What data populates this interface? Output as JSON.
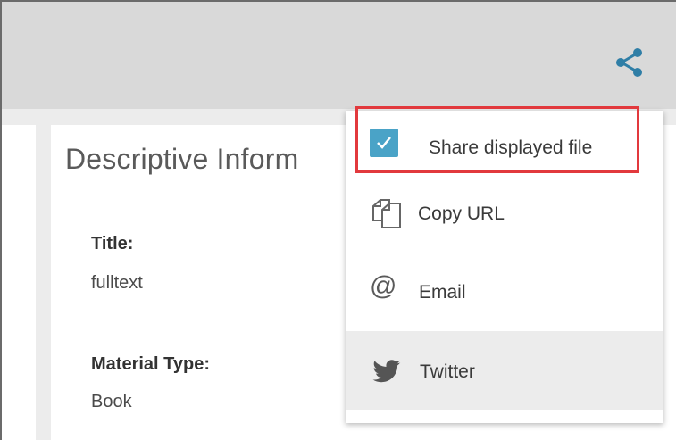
{
  "toolbar": {
    "share_icon": "share-icon"
  },
  "record": {
    "section_heading": "Descriptive Inform",
    "fields": [
      {
        "label": "Title:",
        "value": "fulltext"
      },
      {
        "label": "Material Type:",
        "value": "Book"
      }
    ]
  },
  "share_menu": {
    "share_displayed_file": {
      "label": "Share displayed file",
      "checked": true
    },
    "items": [
      {
        "label": "Copy URL",
        "icon": "copy-icon"
      },
      {
        "label": "Email",
        "icon": "at-sign-icon"
      },
      {
        "label": "Twitter",
        "icon": "twitter-icon"
      }
    ]
  },
  "colors": {
    "toolbar_bg": "#d9d9d9",
    "accent_icon": "#2f7ea6",
    "checkbox": "#4aa3c7",
    "highlight": "#e2393d",
    "hover_row": "#ececec"
  }
}
